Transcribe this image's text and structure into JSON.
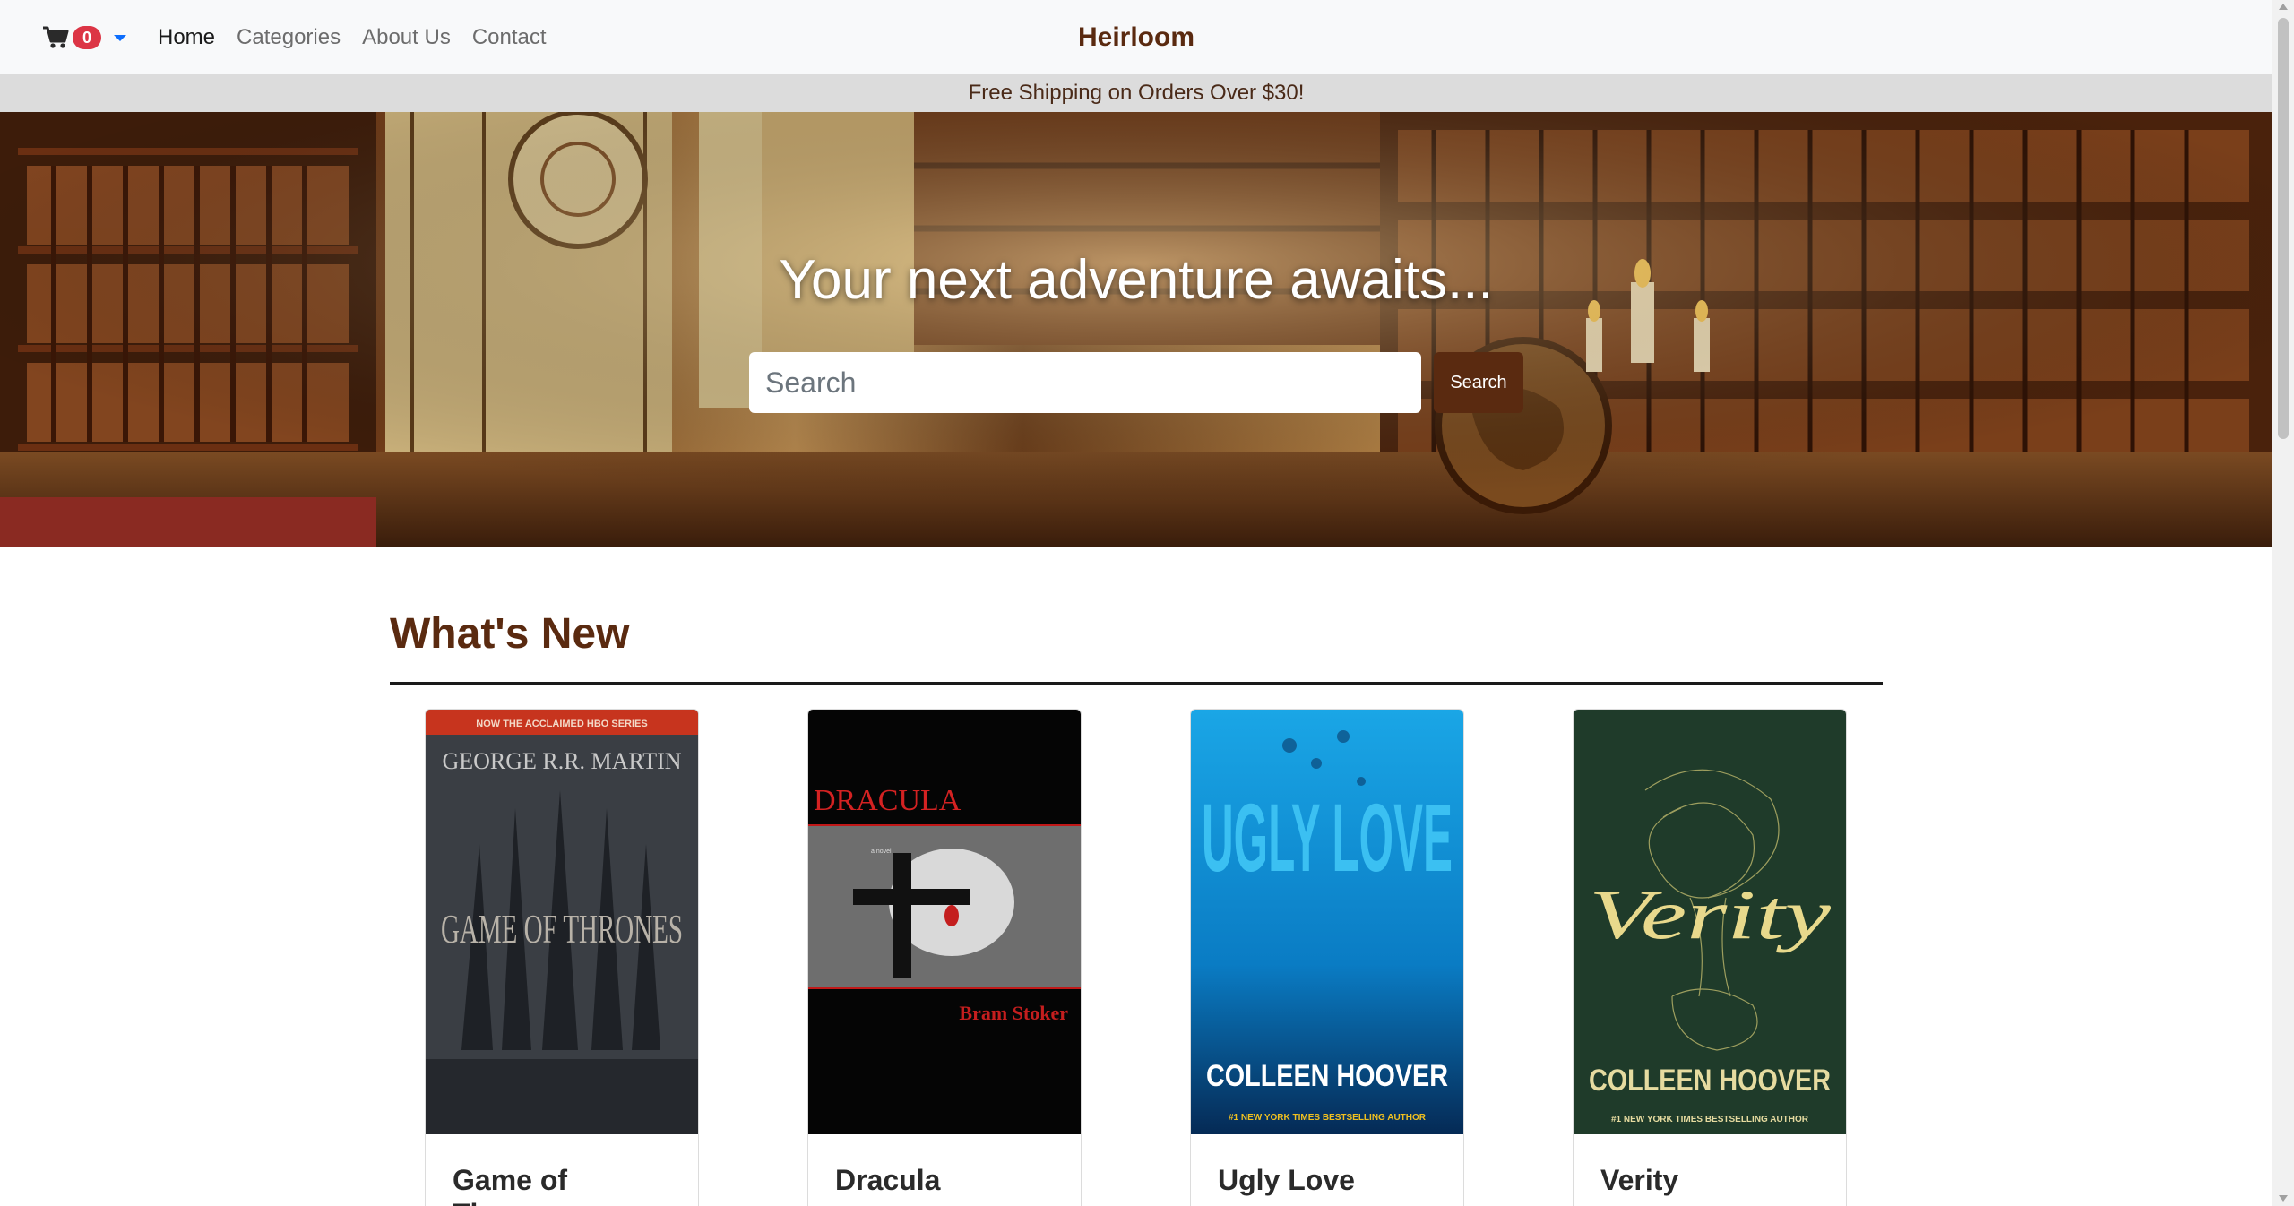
{
  "navbar": {
    "cart": {
      "icon": "shopping-cart-icon",
      "count": "0"
    },
    "links": [
      {
        "label": "Home",
        "active": true
      },
      {
        "label": "Categories",
        "active": false
      },
      {
        "label": "About Us",
        "active": false
      },
      {
        "label": "Contact",
        "active": false
      }
    ],
    "brand": "Heirloom"
  },
  "promo": {
    "text": "Free Shipping on Orders Over $30!"
  },
  "hero": {
    "title": "Your next adventure awaits...",
    "search_placeholder": "Search",
    "search_value": "",
    "search_button": "Search"
  },
  "section": {
    "title": "What's New",
    "books": [
      {
        "title": "Game of Thrones",
        "cover_author": "GEORGE R.R. MARTIN",
        "cover_title": "GAME OF THRONES",
        "cover_tag": "NOW THE ACCLAIMED HBO SERIES"
      },
      {
        "title": "Dracula",
        "cover_author": "Bram Stoker",
        "cover_title": "DRACULA",
        "cover_tag": "a novel"
      },
      {
        "title": "Ugly Love",
        "cover_author": "COLLEEN HOOVER",
        "cover_title": "UGLY LOVE",
        "cover_tag": "#1 NEW YORK TIMES BESTSELLING AUTHOR"
      },
      {
        "title": "Verity",
        "cover_author": "COLLEEN HOOVER",
        "cover_title": "Verity",
        "cover_tag": "#1 NEW YORK TIMES BESTSELLING AUTHOR"
      }
    ]
  },
  "colors": {
    "brand": "#5a2a10",
    "badge": "#dc3545",
    "promo_bg": "#dcdcdc",
    "navbar_bg": "#f8f9fa"
  }
}
